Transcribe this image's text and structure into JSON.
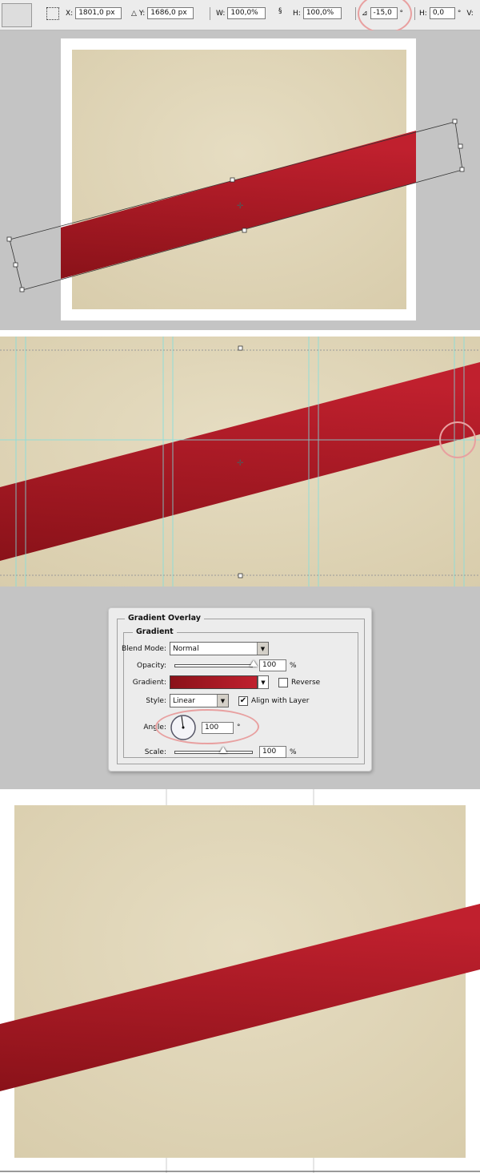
{
  "toolbar": {
    "x_label": "X:",
    "x_value": "1801,0 px",
    "y_label": "Y:",
    "y_value": "1686,0 px",
    "w_label": "W:",
    "w_value": "100,0%",
    "h_label": "H:",
    "h_value": "100,0%",
    "angle_value": "-15,0",
    "angle_unit": "°",
    "skew_h_label": "H:",
    "skew_h_value": "0,0",
    "skew_unit": "°",
    "skew_v_label": "V:"
  },
  "dialog": {
    "title": "Gradient Overlay",
    "group": "Gradient",
    "blend_mode_label": "Blend Mode:",
    "blend_mode_value": "Normal",
    "opacity_label": "Opacity:",
    "opacity_value": "100",
    "opacity_unit": "%",
    "gradient_label": "Gradient:",
    "reverse_label": "Reverse",
    "reverse_checked": false,
    "style_label": "Style:",
    "style_value": "Linear",
    "align_label": "Align with Layer",
    "align_checked": true,
    "angle_label": "Angle:",
    "angle_value": "100",
    "angle_unit": "°",
    "scale_label": "Scale:",
    "scale_value": "100",
    "scale_unit": "%",
    "opacity_percent": 100,
    "scale_percent": 100
  },
  "colors": {
    "ribbon_light": "#c0202e",
    "ribbon_dark": "#8a1219",
    "paper": "#e3dabd",
    "highlight": "#e8a0a0",
    "guide": "#7fe0e0"
  }
}
